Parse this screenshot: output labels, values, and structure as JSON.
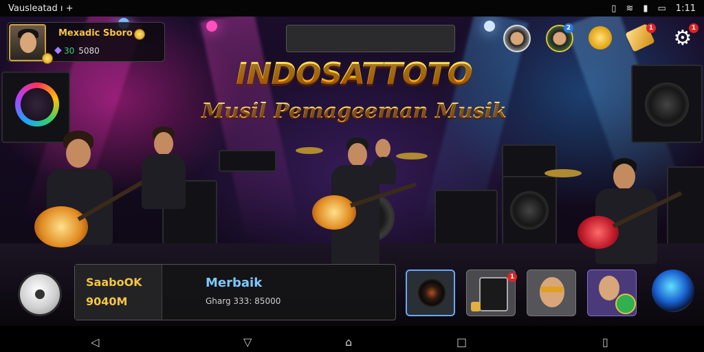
{
  "status_bar": {
    "left_text": "Vausleatad ı +",
    "time": "1:11"
  },
  "player": {
    "name": "Mexadic Sboro",
    "level_value": "30",
    "currency_value": "5080"
  },
  "title": {
    "main": "INDOSATTOTO",
    "subtitle": "Musil Pemageeman Musik"
  },
  "top_icons": [
    {
      "name": "avatar-1",
      "badge": ""
    },
    {
      "name": "avatar-2",
      "badge": "2"
    },
    {
      "name": "coin-icon",
      "badge": ""
    },
    {
      "name": "ticket-icon",
      "badge": "1"
    },
    {
      "name": "settings-icon",
      "badge": "1"
    }
  ],
  "bottom_panel": {
    "left_line1": "SaaboOK",
    "left_line2": "9040M",
    "right_title": "Merbaik",
    "right_sub": "Gharg 333: 85000"
  },
  "bottom_tiles": [
    {
      "name": "speaker-tile",
      "badge": ""
    },
    {
      "name": "amp-tile",
      "badge": "1"
    },
    {
      "name": "character-tile",
      "badge": ""
    },
    {
      "name": "musician-tile",
      "badge": ""
    }
  ],
  "nav_bar": [
    "back",
    "home-triangle",
    "home",
    "recents",
    "rotate"
  ],
  "colors": {
    "accent_gold": "#f5c542",
    "accent_blue": "#7ec8ff",
    "badge_red": "#e02424"
  }
}
